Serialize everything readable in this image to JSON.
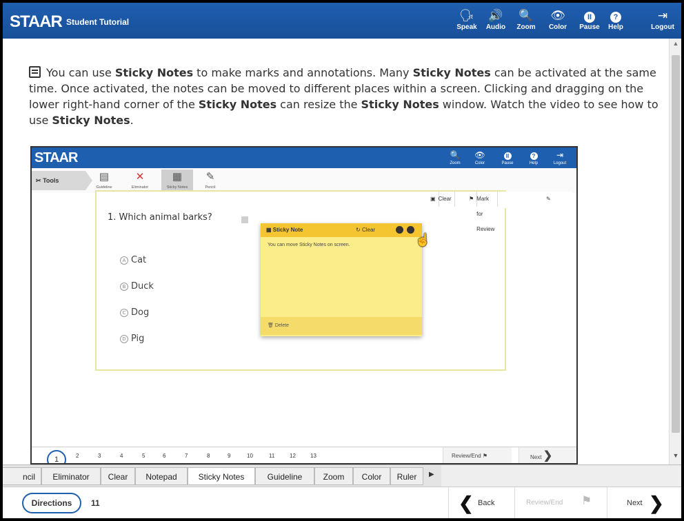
{
  "header": {
    "logo": "STAAR",
    "subtitle": "Student Tutorial",
    "buttons": [
      {
        "label": "Speak",
        "icon": "speak-icon"
      },
      {
        "label": "Audio",
        "icon": "audio-icon"
      },
      {
        "label": "Zoom",
        "icon": "zoom-icon"
      },
      {
        "label": "Color",
        "icon": "eye-icon"
      },
      {
        "label": "Pause",
        "icon": "pause-icon"
      },
      {
        "label": "Help",
        "icon": "help-icon"
      },
      {
        "label": "Logout",
        "icon": "logout-icon"
      }
    ]
  },
  "intro": {
    "parts": [
      "You can use ",
      "Sticky Notes",
      " to make marks and annotations. Many ",
      "Sticky Notes",
      " can be activated at the same time. Once activated, the notes can be moved to different places within a screen. Clicking and dragging on the lower right-hand corner of the ",
      "Sticky Notes",
      " can resize the ",
      "Sticky Notes",
      " window. Watch the video to see how to use ",
      "Sticky Notes",
      "."
    ]
  },
  "video": {
    "logo": "STAAR",
    "top_buttons": [
      "Zoom",
      "Color",
      "Pause",
      "Help",
      "Logout"
    ],
    "tools_label": "Tools",
    "tools": [
      "Guideline",
      "Eliminator",
      "Sticky Notes",
      "Pencil"
    ],
    "question_tools": [
      "Clear",
      "Mark for Review"
    ],
    "question": "1.  Which animal barks?",
    "answers": [
      {
        "letter": "A",
        "text": "Cat"
      },
      {
        "letter": "B",
        "text": "Duck"
      },
      {
        "letter": "C",
        "text": "Dog"
      },
      {
        "letter": "D",
        "text": "Pig"
      }
    ],
    "sticky": {
      "title": "Sticky Note",
      "clear": "Clear",
      "body": "You can move Sticky Notes on screen.",
      "delete": "Delete"
    },
    "nav": {
      "current": "1",
      "pages": [
        "2",
        "3",
        "4",
        "5",
        "6",
        "7",
        "8",
        "9",
        "10",
        "11",
        "12",
        "13"
      ],
      "review": "Review/End",
      "next": "Next"
    }
  },
  "tool_tabs": [
    "ncil",
    "Eliminator",
    "Clear",
    "Notepad",
    "Sticky Notes",
    "Guideline",
    "Zoom",
    "Color",
    "Ruler"
  ],
  "bottom": {
    "directions": "Directions",
    "question_number": "11",
    "back": "Back",
    "review": "Review/End",
    "next": "Next"
  }
}
